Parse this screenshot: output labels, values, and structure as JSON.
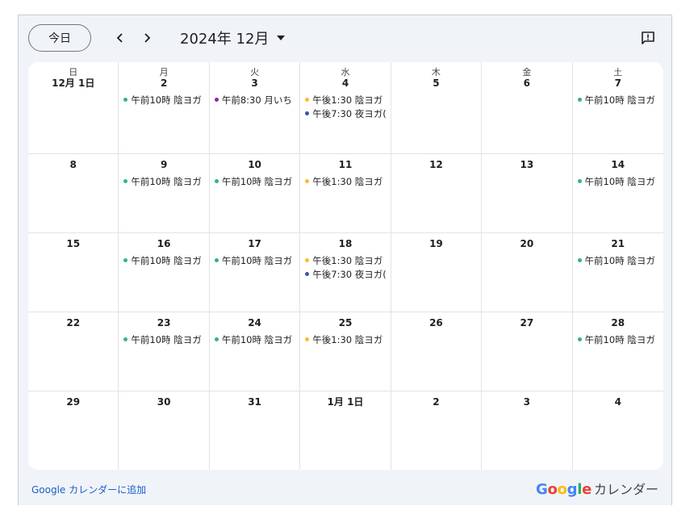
{
  "toolbar": {
    "today_label": "今日",
    "month_title": "2024年 12月"
  },
  "colors": {
    "green": "#33b679",
    "purple": "#8e24aa",
    "yellow": "#f6bf26",
    "blue": "#3f51b5"
  },
  "weekdays": [
    "日",
    "月",
    "火",
    "水",
    "木",
    "金",
    "土"
  ],
  "weeks": [
    [
      {
        "day": "12月 1日",
        "events": []
      },
      {
        "day": "2",
        "events": [
          {
            "text": "午前10時 陰ヨガ",
            "color": "green"
          }
        ]
      },
      {
        "day": "3",
        "events": [
          {
            "text": "午前8:30 月いち",
            "color": "purple"
          }
        ]
      },
      {
        "day": "4",
        "events": [
          {
            "text": "午後1:30 陰ヨガ",
            "color": "yellow"
          },
          {
            "text": "午後7:30 夜ヨガ(",
            "color": "blue"
          }
        ]
      },
      {
        "day": "5",
        "events": []
      },
      {
        "day": "6",
        "events": []
      },
      {
        "day": "7",
        "events": [
          {
            "text": "午前10時 陰ヨガ",
            "color": "green"
          }
        ]
      }
    ],
    [
      {
        "day": "8",
        "events": []
      },
      {
        "day": "9",
        "events": [
          {
            "text": "午前10時 陰ヨガ",
            "color": "green"
          }
        ]
      },
      {
        "day": "10",
        "events": [
          {
            "text": "午前10時 陰ヨガ",
            "color": "green"
          }
        ]
      },
      {
        "day": "11",
        "events": [
          {
            "text": "午後1:30 陰ヨガ",
            "color": "yellow"
          }
        ]
      },
      {
        "day": "12",
        "events": []
      },
      {
        "day": "13",
        "events": []
      },
      {
        "day": "14",
        "events": [
          {
            "text": "午前10時 陰ヨガ",
            "color": "green"
          }
        ]
      }
    ],
    [
      {
        "day": "15",
        "events": []
      },
      {
        "day": "16",
        "events": [
          {
            "text": "午前10時 陰ヨガ",
            "color": "green"
          }
        ]
      },
      {
        "day": "17",
        "events": [
          {
            "text": "午前10時 陰ヨガ",
            "color": "green"
          }
        ]
      },
      {
        "day": "18",
        "events": [
          {
            "text": "午後1:30 陰ヨガ",
            "color": "yellow"
          },
          {
            "text": "午後7:30 夜ヨガ(",
            "color": "blue"
          }
        ]
      },
      {
        "day": "19",
        "events": []
      },
      {
        "day": "20",
        "events": []
      },
      {
        "day": "21",
        "events": [
          {
            "text": "午前10時 陰ヨガ",
            "color": "green"
          }
        ]
      }
    ],
    [
      {
        "day": "22",
        "events": []
      },
      {
        "day": "23",
        "events": [
          {
            "text": "午前10時 陰ヨガ",
            "color": "green"
          }
        ]
      },
      {
        "day": "24",
        "events": [
          {
            "text": "午前10時 陰ヨガ",
            "color": "green"
          }
        ]
      },
      {
        "day": "25",
        "events": [
          {
            "text": "午後1:30 陰ヨガ",
            "color": "yellow"
          }
        ]
      },
      {
        "day": "26",
        "events": []
      },
      {
        "day": "27",
        "events": []
      },
      {
        "day": "28",
        "events": [
          {
            "text": "午前10時 陰ヨガ",
            "color": "green"
          }
        ]
      }
    ],
    [
      {
        "day": "29",
        "events": []
      },
      {
        "day": "30",
        "events": []
      },
      {
        "day": "31",
        "events": []
      },
      {
        "day": "1月 1日",
        "events": []
      },
      {
        "day": "2",
        "events": []
      },
      {
        "day": "3",
        "events": []
      },
      {
        "day": "4",
        "events": []
      }
    ]
  ],
  "footer": {
    "add_link": "Google カレンダーに追加",
    "brand_logo": "Google",
    "brand_name": "カレンダー",
    "logo_colors": [
      "#4285f4",
      "#ea4335",
      "#fbbc05",
      "#4285f4",
      "#34a853",
      "#ea4335"
    ]
  }
}
